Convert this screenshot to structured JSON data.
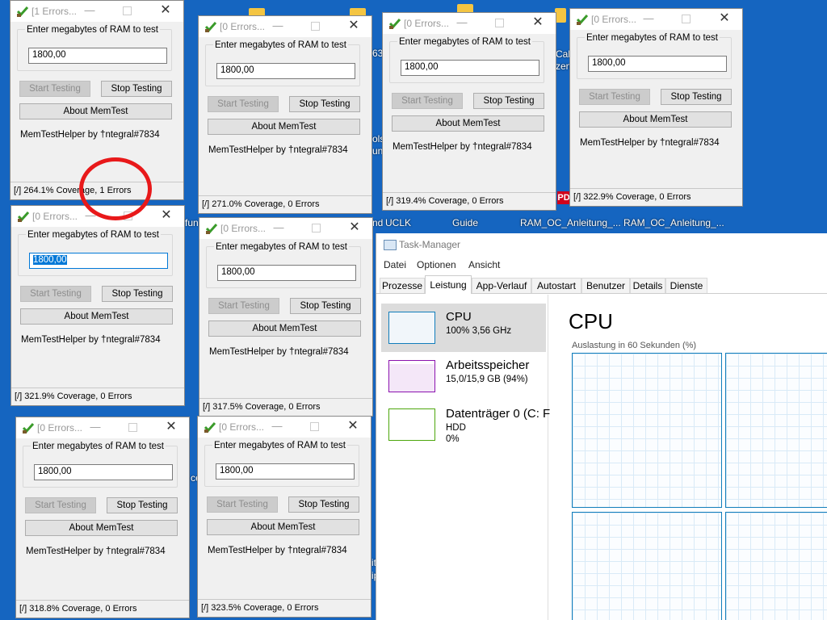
{
  "desktop": {
    "fragments": [
      "63",
      "Calc",
      "zen",
      "ols",
      "un",
      "UCLK",
      "nd",
      "Guide",
      "RAM_OC_Anleitung_...",
      "RAM_OC_Anleitung_...",
      "fun",
      "ce",
      "it",
      "ip",
      "PD"
    ]
  },
  "memtest": {
    "legend": "Enter megabytes of RAM to test",
    "start_label": "Start Testing",
    "stop_label": "Stop Testing",
    "about_label": "About MemTest",
    "credit": "MemTestHelper by †ntegral#7834",
    "windows": [
      {
        "title": "[1 Errors...",
        "value": "1800,00",
        "status": "[/]   264.1% Coverage, 1 Errors"
      },
      {
        "title": "[0 Errors...",
        "value": "1800,00",
        "status": "[/]   271.0% Coverage, 0 Errors"
      },
      {
        "title": "[0 Errors...",
        "value": "1800,00",
        "status": "[/]   319.4% Coverage, 0 Errors"
      },
      {
        "title": "[0 Errors...",
        "value": "1800,00",
        "status": "[/]   322.9% Coverage, 0 Errors"
      },
      {
        "title": "[0 Errors...",
        "value": "1800,00",
        "status": "[/]   321.9% Coverage, 0 Errors"
      },
      {
        "title": "[0 Errors...",
        "value": "1800,00",
        "status": "[/]   317.5% Coverage, 0 Errors"
      },
      {
        "title": "[0 Errors...",
        "value": "1800,00",
        "status": "[/]   318.8% Coverage, 0 Errors"
      },
      {
        "title": "[0 Errors...",
        "value": "1800,00",
        "status": "[/]   323.5% Coverage, 0 Errors"
      }
    ]
  },
  "taskmanager": {
    "title": "Task-Manager",
    "menu": [
      "Datei",
      "Optionen",
      "Ansicht"
    ],
    "tabs": [
      "Prozesse",
      "Leistung",
      "App-Verlauf",
      "Autostart",
      "Benutzer",
      "Details",
      "Dienste"
    ],
    "side": [
      {
        "name": "CPU",
        "line1": "100% 3,56 GHz",
        "line2": "",
        "color": "#117dbb"
      },
      {
        "name": "Arbeitsspeicher",
        "line1": "15,0/15,9 GB (94%)",
        "line2": "",
        "color": "#8b12ae"
      },
      {
        "name": "Datenträger 0 (C: F",
        "line1": "HDD",
        "line2": "0%",
        "color": "#4da60c"
      }
    ],
    "main_title": "CPU",
    "graph_label": "Auslastung in 60 Sekunden (%)"
  },
  "colors": {
    "desktop": "#1565c0",
    "highlight_circle": "#e8191a",
    "accent": "#0078d7"
  }
}
